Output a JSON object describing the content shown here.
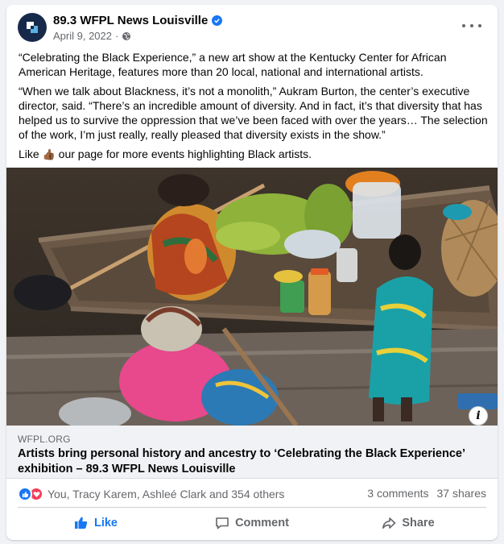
{
  "post": {
    "page_name": "89.3 WFPL News Louisville",
    "date": "April 9, 2022",
    "privacy_icon": "globe-icon",
    "paragraphs": [
      "“Celebrating the Black Experience,” a new art show at the Kentucky Center for African American Heritage, features more than 20 local, national and international artists.",
      "“When we talk about Blackness, it’s not a monolith,” Aukram Burton, the center’s executive director, said. “There’s an incredible amount of diversity. And in fact, it’s that diversity that has helped us to survive the oppression that we’ve been faced with over the years… The selection of the work, I’m just really, really pleased that diversity exists in the show.”"
    ],
    "cta_before": "Like",
    "cta_emoji": "👍🏾",
    "cta_after": "our page for more events highlighting Black artists."
  },
  "link_preview": {
    "domain": "WFPL.ORG",
    "title": "Artists bring personal history and ancestry to ‘Celebrating the Black Experience’ exhibition – 89.3 WFPL News Louisville"
  },
  "stats": {
    "reaction_names": "You, Tracy Karem, Ashleé Clark and 354 others",
    "comments": "3 comments",
    "shares": "37 shares"
  },
  "actions": {
    "like": "Like",
    "comment": "Comment",
    "share": "Share"
  },
  "colors": {
    "accent": "#1877f2",
    "love": "#f33e58",
    "secondary_text": "#65676b"
  }
}
